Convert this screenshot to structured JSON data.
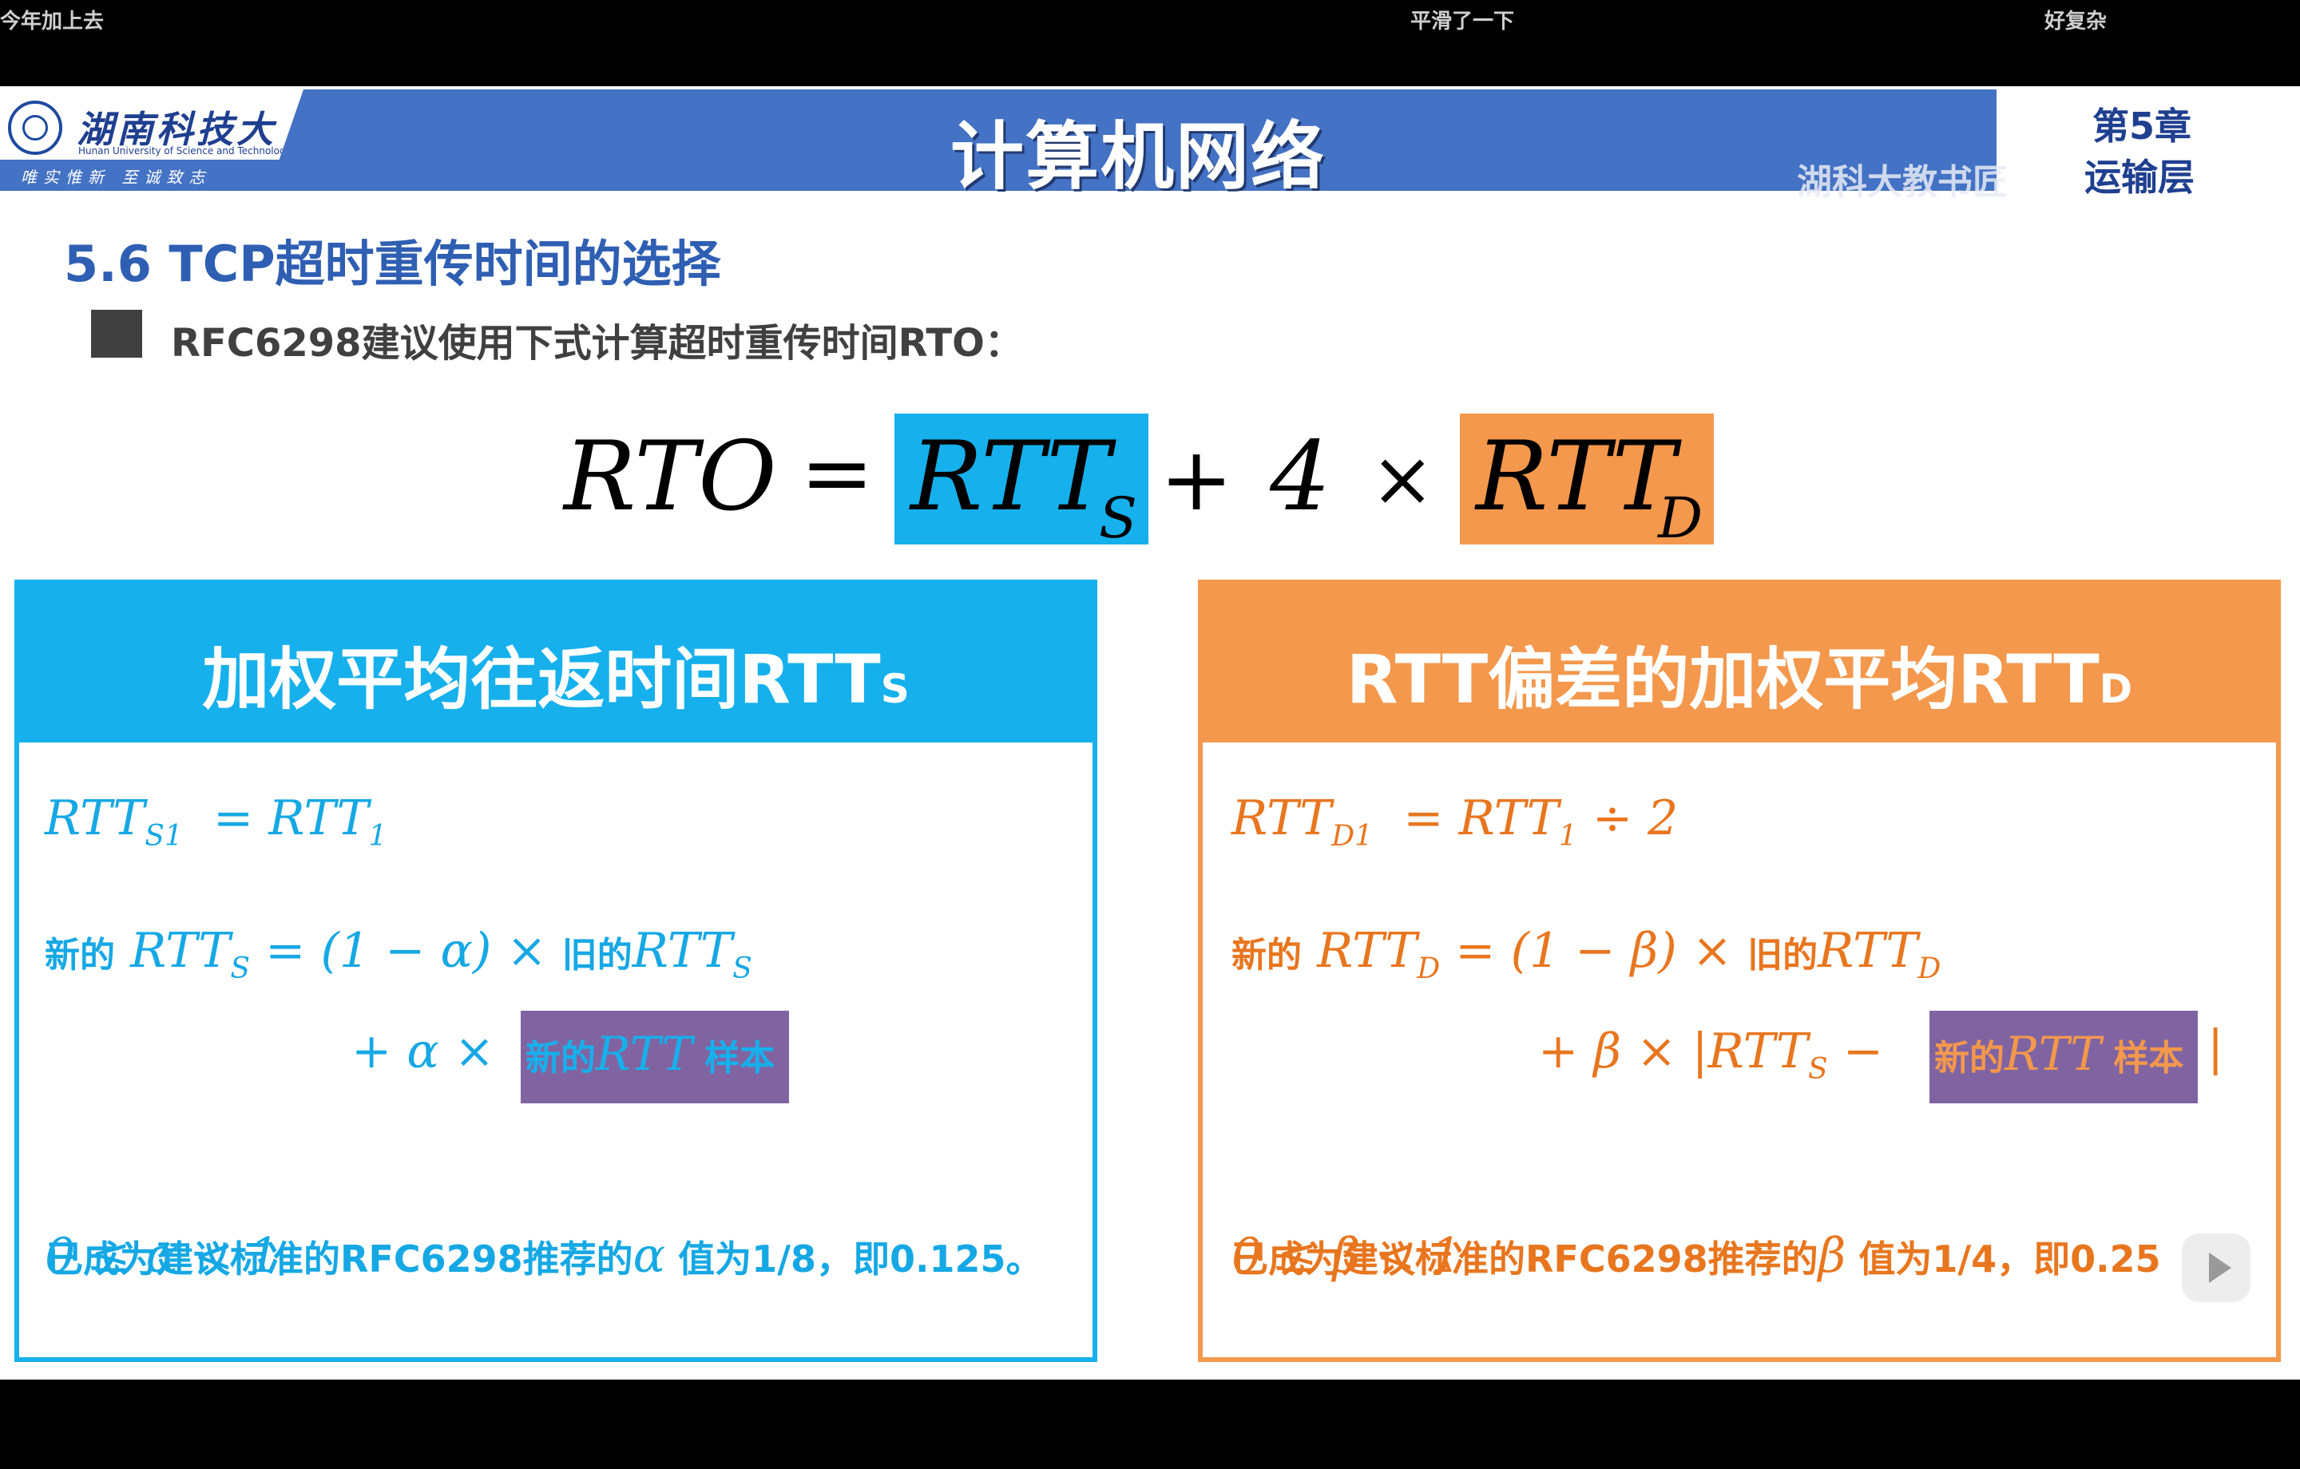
{
  "danmaku": [
    "今年加上去",
    "平滑了一下",
    "好复杂"
  ],
  "header": {
    "logo_name": "湖南科技大学",
    "logo_en": "Hunan University of Science and Technology",
    "logo_motto": "唯实惟新  至诚致志",
    "title": "计算机网络",
    "chapter": "第5章",
    "chapter_name": "运输层",
    "watermark": "湖科大教书匠"
  },
  "section": {
    "title": "5.6 TCP超时重传时间的选择",
    "bullet": "RFC6298建议使用下式计算超时重传时间RTO："
  },
  "formula": {
    "lhs": "RTO",
    "eq": "=",
    "rtts": "RTT",
    "rtts_sub": "S",
    "plus": "+",
    "four": "4",
    "times": "×",
    "rttd": "RTT",
    "rttd_sub": "D"
  },
  "left_panel": {
    "title": "加权平均往返时间RTT",
    "title_sub": "S",
    "eq1_lhs": "RTT",
    "eq1_lhs_sub": "S1",
    "eq1_rhs": "= RTT",
    "eq1_rhs_sub": "1",
    "new_label": "新的",
    "eq2_a": "RTT",
    "eq2_a_sub": "S",
    "eq2_b": " = (1 − α) × ",
    "old_label": "旧的",
    "eq2_c": "RTT",
    "eq2_c_sub": "S",
    "eq3": "+ α ×",
    "sample_new": "新的",
    "sample_rtt": "RTT",
    "sample_label": " 样本",
    "range": "0 ≤ α < 1",
    "note_a": "已成为建议标准的RFC6298推荐的",
    "note_greek": "α",
    "note_b": " 值为1/8，即0.125。"
  },
  "right_panel": {
    "title": "RTT偏差的加权平均RTT",
    "title_sub": "D",
    "eq1_lhs": "RTT",
    "eq1_lhs_sub": "D1",
    "eq1_rhs": "= RTT",
    "eq1_rhs_sub": "1",
    "eq1_tail": " ÷ 2",
    "new_label": "新的",
    "eq2_a": "RTT",
    "eq2_a_sub": "D",
    "eq2_b": " = (1 − β) × ",
    "old_label": "旧的",
    "eq2_c": "RTT",
    "eq2_c_sub": "D",
    "eq3": "+ β × |RTT",
    "eq3_sub": "S",
    "eq3_minus": " −",
    "sample_new": "新的",
    "sample_rtt": "RTT",
    "sample_label": " 样本",
    "abs_close": "|",
    "range": "0 ≤ β < 1",
    "note_a": "已成为建议标准的RFC6298推荐的",
    "note_greek": "β",
    "note_b": " 值为1/4，即0.25"
  },
  "colors": {
    "header_blue": "#4472c4",
    "rtts_blue": "#16b0ec",
    "rttd_orange": "#f3984c",
    "sample_purple": "#8064a2"
  },
  "icons": {
    "video_play": "play-icon"
  }
}
